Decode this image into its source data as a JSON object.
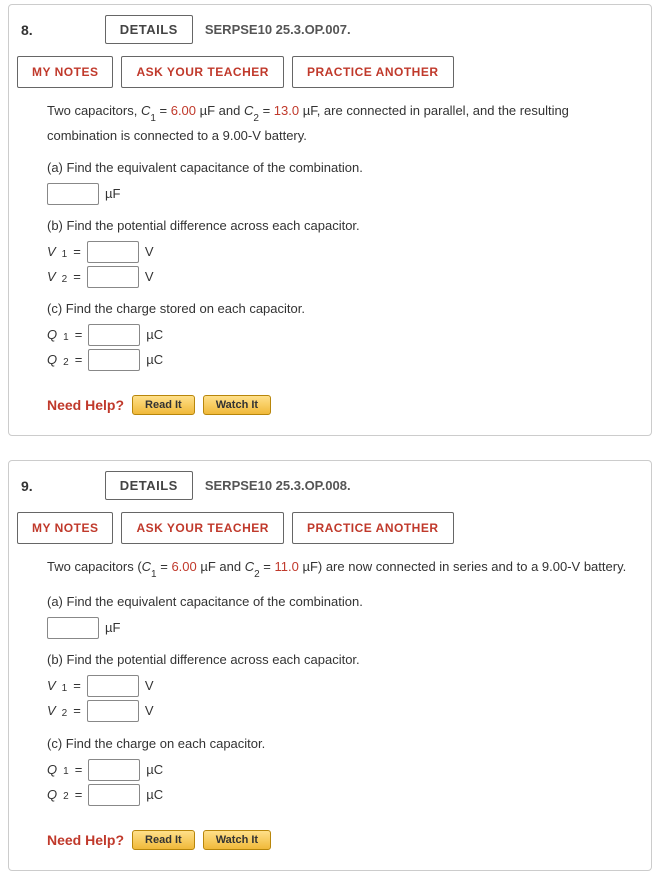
{
  "problems": [
    {
      "number": "8.",
      "details_label": "DETAILS",
      "code": "SERPSE10 25.3.OP.007.",
      "my_notes": "MY NOTES",
      "ask_teacher": "ASK YOUR TEACHER",
      "practice": "PRACTICE ANOTHER",
      "stem_pre": "Two capacitors, ",
      "c1_label": "C",
      "c1_sub": "1",
      "eq": " = ",
      "c1_val": "6.00",
      "stem_mid1": " µF and ",
      "c2_label": "C",
      "c2_sub": "2",
      "c2_val": "13.0",
      "stem_post": " µF, are connected in parallel, and the resulting combination is connected to a 9.00-V battery.",
      "parts": {
        "a": {
          "label": "(a) Find the equivalent capacitance of the combination.",
          "unit": "µF"
        },
        "b": {
          "label": "(b) Find the potential difference across each capacitor.",
          "v1_pre": "V",
          "v1_sub": "1",
          "v1_eq": " = ",
          "v1_unit": "V",
          "v2_pre": "V",
          "v2_sub": "2",
          "v2_eq": " = ",
          "v2_unit": "V"
        },
        "c": {
          "label": "(c) Find the charge stored on each capacitor.",
          "q1_pre": "Q",
          "q1_sub": "1",
          "q1_eq": " = ",
          "q1_unit": "µC",
          "q2_pre": "Q",
          "q2_sub": "2",
          "q2_eq": " = ",
          "q2_unit": "µC"
        }
      },
      "need_help": "Need Help?",
      "read_it": "Read It",
      "watch_it": "Watch It"
    },
    {
      "number": "9.",
      "details_label": "DETAILS",
      "code": "SERPSE10 25.3.OP.008.",
      "my_notes": "MY NOTES",
      "ask_teacher": "ASK YOUR TEACHER",
      "practice": "PRACTICE ANOTHER",
      "stem_pre": "Two capacitors (",
      "c1_label": "C",
      "c1_sub": "1",
      "eq": " = ",
      "c1_val": "6.00",
      "stem_mid1": " µF and ",
      "c2_label": "C",
      "c2_sub": "2",
      "c2_val": "11.0",
      "stem_post": " µF) are now connected in series and to a 9.00-V battery.",
      "parts": {
        "a": {
          "label": "(a) Find the equivalent capacitance of the combination.",
          "unit": "µF"
        },
        "b": {
          "label": "(b) Find the potential difference across each capacitor.",
          "v1_pre": "V",
          "v1_sub": "1",
          "v1_eq": " = ",
          "v1_unit": "V",
          "v2_pre": "V",
          "v2_sub": "2",
          "v2_eq": " = ",
          "v2_unit": "V"
        },
        "c": {
          "label": "(c) Find the charge on each capacitor.",
          "q1_pre": "Q",
          "q1_sub": "1",
          "q1_eq": " = ",
          "q1_unit": "µC",
          "q2_pre": "Q",
          "q2_sub": "2",
          "q2_eq": " = ",
          "q2_unit": "µC"
        }
      },
      "need_help": "Need Help?",
      "read_it": "Read It",
      "watch_it": "Watch It"
    }
  ]
}
